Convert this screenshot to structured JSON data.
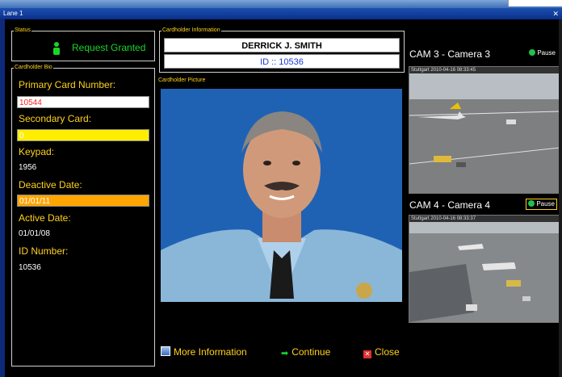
{
  "window": {
    "title": "Lane 1"
  },
  "status": {
    "legend": "Status",
    "text": "Request Granted"
  },
  "bio": {
    "legend": "Cardholder Bio",
    "primary_label": "Primary Card Number:",
    "primary_value": "10544",
    "secondary_label": "Secondary Card:",
    "secondary_value": "0",
    "keypad_label": "Keypad:",
    "keypad_value": "1956",
    "deactive_label": "Deactive Date:",
    "deactive_value": "01/01/11",
    "active_label": "Active Date:",
    "active_value": "01/01/08",
    "id_label": "ID Number:",
    "id_value": "10536"
  },
  "holder": {
    "legend": "Cardholder Information",
    "name": "DERRICK J. SMITH",
    "id_line": "ID :: 10536"
  },
  "picture": {
    "label": "Cardholder Picture"
  },
  "actions": {
    "more_info": "More Information",
    "continue": "Continue",
    "close": "Close"
  },
  "cams": [
    {
      "title": "CAM 3 - Camera 3",
      "pause": "Pause",
      "stamp": "Stuttgart 2010-04-16 08:33:45"
    },
    {
      "title": "CAM 4 - Camera 4",
      "pause": "Pause",
      "stamp": "Stuttgart 2010-04-16 08:33:37"
    }
  ],
  "colors": {
    "label": "#ffd21c",
    "granted": "#19d629",
    "secondary": "#ffee00",
    "deactive": "#ffa500",
    "id_text": "#1a39d6",
    "primary_text": "#ff2222"
  },
  "icons": {
    "status": "person-icon",
    "more_info": "info-window-icon",
    "continue": "arrow-right-icon",
    "close": "close-x-icon",
    "pause": "pause-icon"
  }
}
